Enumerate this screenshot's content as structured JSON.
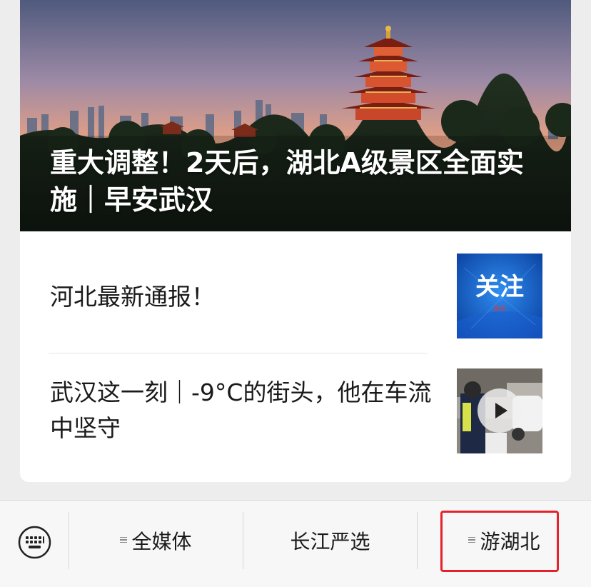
{
  "feed": {
    "hero": {
      "title": "重大调整！2天后，湖北A级景区全面实施｜早安武汉",
      "image": "yellow-crane-tower-sunset-photo"
    },
    "articles": [
      {
        "title": "河北最新通报！",
        "thumbnail": {
          "text": "关注",
          "subtext": "发布",
          "type": "image"
        }
      },
      {
        "title": "武汉这一刻｜-9°C的街头，他在车流中坚守",
        "thumbnail": {
          "type": "video",
          "icon": "play-icon"
        }
      }
    ]
  },
  "bottom_menu": {
    "keyboard_icon": "keyboard-icon",
    "items": [
      {
        "label": "全媒体",
        "has_submenu": true
      },
      {
        "label": "长江严选",
        "has_submenu": false
      },
      {
        "label": "游湖北",
        "has_submenu": true,
        "highlighted": true
      }
    ],
    "highlight_color": "#e5222b"
  }
}
